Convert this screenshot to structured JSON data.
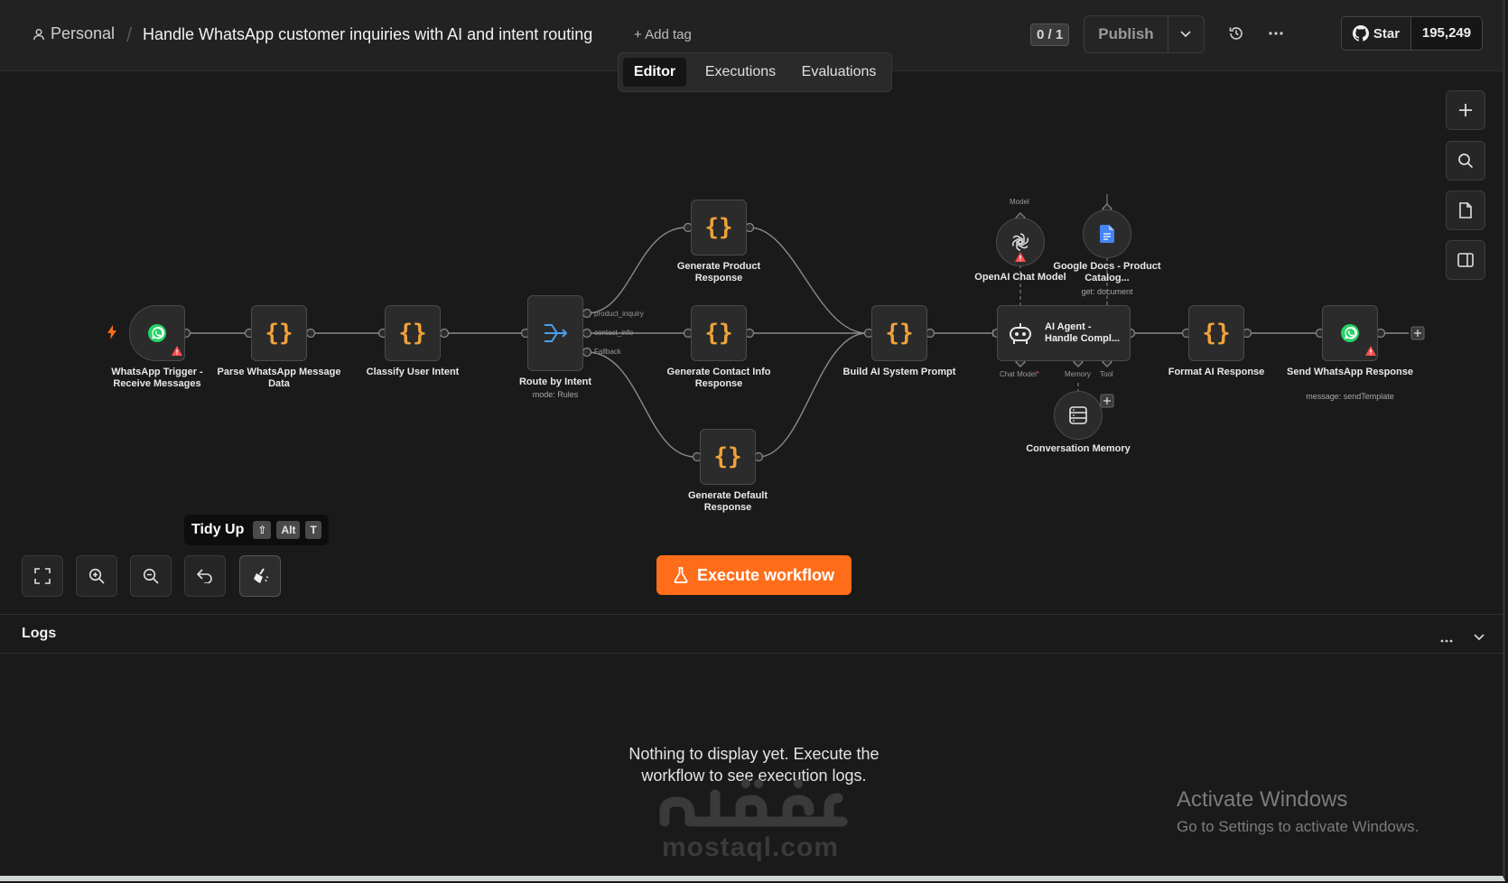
{
  "header": {
    "project": "Personal",
    "separator": "/",
    "workflow_title": "Handle WhatsApp customer inquiries with AI and intent routing",
    "add_tag": "+ Add tag",
    "version_count": "0 / 1",
    "publish_label": "Publish",
    "github_star": "Star",
    "github_count": "195,249"
  },
  "tabs": [
    {
      "label": "Editor",
      "active": true
    },
    {
      "label": "Executions",
      "active": false
    },
    {
      "label": "Evaluations",
      "active": false
    }
  ],
  "nodes": {
    "trigger": {
      "label": "WhatsApp Trigger - Receive Messages"
    },
    "parse": {
      "label": "Parse WhatsApp Message Data"
    },
    "classify": {
      "label": "Classify User Intent"
    },
    "route": {
      "label": "Route by Intent",
      "sub": "mode: Rules",
      "outputs": [
        "product_inquiry",
        "contact_info",
        "Fallback"
      ]
    },
    "gen_product": {
      "label": "Generate Product Response"
    },
    "gen_contact": {
      "label": "Generate Contact Info Response"
    },
    "gen_default": {
      "label": "Generate Default Response"
    },
    "build_prompt": {
      "label": "Build AI System Prompt"
    },
    "openai": {
      "label": "OpenAI Chat Model",
      "port": "Model"
    },
    "gdocs": {
      "label": "Google Docs - Product Catalog...",
      "sub": "get: document"
    },
    "agent": {
      "label": "AI Agent - Handle Compl...",
      "ports": {
        "chat_model": "Chat Model",
        "memory": "Memory",
        "tool": "Tool"
      }
    },
    "memory": {
      "label": "Conversation Memory"
    },
    "format": {
      "label": "Format AI Response"
    },
    "send": {
      "label": "Send WhatsApp Response",
      "sub": "message: sendTemplate"
    }
  },
  "canvas_controls": {
    "tidy_up": "Tidy Up",
    "tidy_keys": [
      "⇧",
      "Alt",
      "T"
    ],
    "execute_label": "Execute workflow"
  },
  "logs": {
    "title": "Logs",
    "empty_line1": "Nothing to display yet. Execute the",
    "empty_line2": "workflow to see execution logs."
  },
  "watermark": {
    "arabic": "مستقل",
    "latin": "mostaql.com"
  },
  "activate": {
    "line1": "Activate Windows",
    "line2": "Go to Settings to activate Windows."
  },
  "colors": {
    "accent": "#ff6d1a",
    "code_node": "#f0a23a",
    "router": "#4a9ff0",
    "whatsapp": "#25d366",
    "warning": "#ff4d4d"
  }
}
